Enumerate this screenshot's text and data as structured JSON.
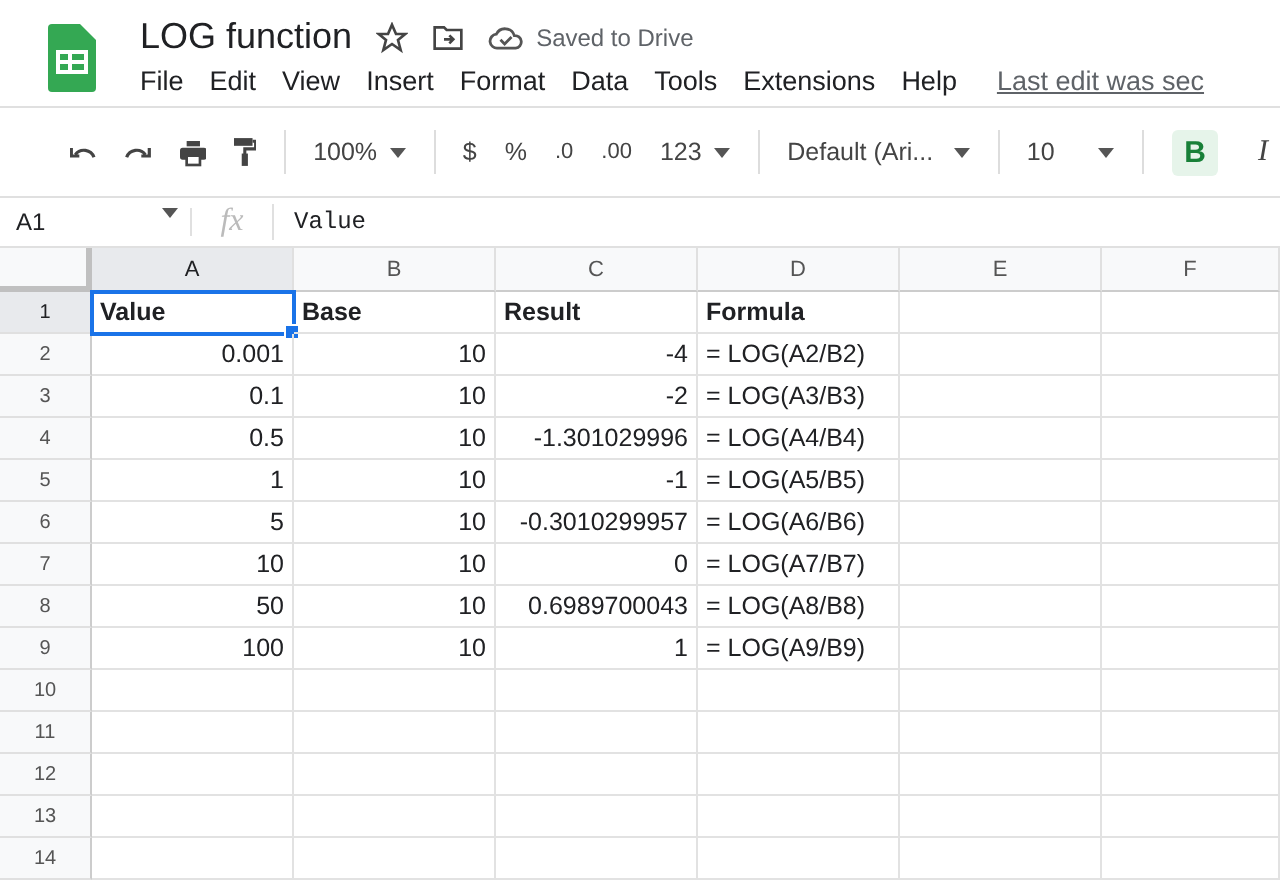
{
  "document": {
    "title": "LOG function",
    "save_status": "Saved to Drive"
  },
  "menu": [
    "File",
    "Edit",
    "View",
    "Insert",
    "Format",
    "Data",
    "Tools",
    "Extensions",
    "Help"
  ],
  "last_edit": "Last edit was sec",
  "toolbar": {
    "zoom": "100%",
    "currency": "$",
    "percent": "%",
    "decrease_decimal": ".0",
    "increase_decimal": ".00",
    "number_format": "123",
    "font": "Default (Ari...",
    "font_size": "10",
    "bold": {
      "label": "B",
      "selected": true
    },
    "italic": {
      "label": "I",
      "selected": false
    }
  },
  "formula_bar": {
    "cell_ref": "A1",
    "fx": "fx",
    "value": "Value"
  },
  "columns": [
    {
      "label": "A",
      "selected": true
    },
    {
      "label": "B",
      "selected": false
    },
    {
      "label": "C",
      "selected": false
    },
    {
      "label": "D",
      "selected": false
    },
    {
      "label": "E",
      "selected": false
    },
    {
      "label": "F",
      "selected": false
    }
  ],
  "rows": [
    {
      "number": "1",
      "selected": true,
      "cells": [
        {
          "text": "Value",
          "kind": "header",
          "selected": true
        },
        {
          "text": "Base",
          "kind": "header",
          "selected": false
        },
        {
          "text": "Result",
          "kind": "header",
          "selected": false
        },
        {
          "text": "Formula",
          "kind": "header",
          "selected": false
        }
      ]
    },
    {
      "number": "2",
      "selected": false,
      "cells": [
        {
          "text": "0.001",
          "kind": "number",
          "selected": false
        },
        {
          "text": "10",
          "kind": "number",
          "selected": false
        },
        {
          "text": "-4",
          "kind": "number",
          "selected": false
        },
        {
          "text": "= LOG(A2/B2)",
          "kind": "text",
          "selected": false
        }
      ]
    },
    {
      "number": "3",
      "selected": false,
      "cells": [
        {
          "text": "0.1",
          "kind": "number",
          "selected": false
        },
        {
          "text": "10",
          "kind": "number",
          "selected": false
        },
        {
          "text": "-2",
          "kind": "number",
          "selected": false
        },
        {
          "text": "= LOG(A3/B3)",
          "kind": "text",
          "selected": false
        }
      ]
    },
    {
      "number": "4",
      "selected": false,
      "cells": [
        {
          "text": "0.5",
          "kind": "number",
          "selected": false
        },
        {
          "text": "10",
          "kind": "number",
          "selected": false
        },
        {
          "text": "-1.301029996",
          "kind": "number",
          "selected": false
        },
        {
          "text": "= LOG(A4/B4)",
          "kind": "text",
          "selected": false
        }
      ]
    },
    {
      "number": "5",
      "selected": false,
      "cells": [
        {
          "text": "1",
          "kind": "number",
          "selected": false
        },
        {
          "text": "10",
          "kind": "number",
          "selected": false
        },
        {
          "text": "-1",
          "kind": "number",
          "selected": false
        },
        {
          "text": "= LOG(A5/B5)",
          "kind": "text",
          "selected": false
        }
      ]
    },
    {
      "number": "6",
      "selected": false,
      "cells": [
        {
          "text": "5",
          "kind": "number",
          "selected": false
        },
        {
          "text": "10",
          "kind": "number",
          "selected": false
        },
        {
          "text": "-0.3010299957",
          "kind": "number",
          "selected": false
        },
        {
          "text": "= LOG(A6/B6)",
          "kind": "text",
          "selected": false
        }
      ]
    },
    {
      "number": "7",
      "selected": false,
      "cells": [
        {
          "text": "10",
          "kind": "number",
          "selected": false
        },
        {
          "text": "10",
          "kind": "number",
          "selected": false
        },
        {
          "text": "0",
          "kind": "number",
          "selected": false
        },
        {
          "text": "= LOG(A7/B7)",
          "kind": "text",
          "selected": false
        }
      ]
    },
    {
      "number": "8",
      "selected": false,
      "cells": [
        {
          "text": "50",
          "kind": "number",
          "selected": false
        },
        {
          "text": "10",
          "kind": "number",
          "selected": false
        },
        {
          "text": "0.6989700043",
          "kind": "number",
          "selected": false
        },
        {
          "text": "= LOG(A8/B8)",
          "kind": "text",
          "selected": false
        }
      ]
    },
    {
      "number": "9",
      "selected": false,
      "cells": [
        {
          "text": "100",
          "kind": "number",
          "selected": false
        },
        {
          "text": "10",
          "kind": "number",
          "selected": false
        },
        {
          "text": "1",
          "kind": "number",
          "selected": false
        },
        {
          "text": "= LOG(A9/B9)",
          "kind": "text",
          "selected": false
        }
      ]
    },
    {
      "number": "10",
      "selected": false
    },
    {
      "number": "11",
      "selected": false
    },
    {
      "number": "12",
      "selected": false
    },
    {
      "number": "13",
      "selected": false
    },
    {
      "number": "14",
      "selected": false
    }
  ]
}
